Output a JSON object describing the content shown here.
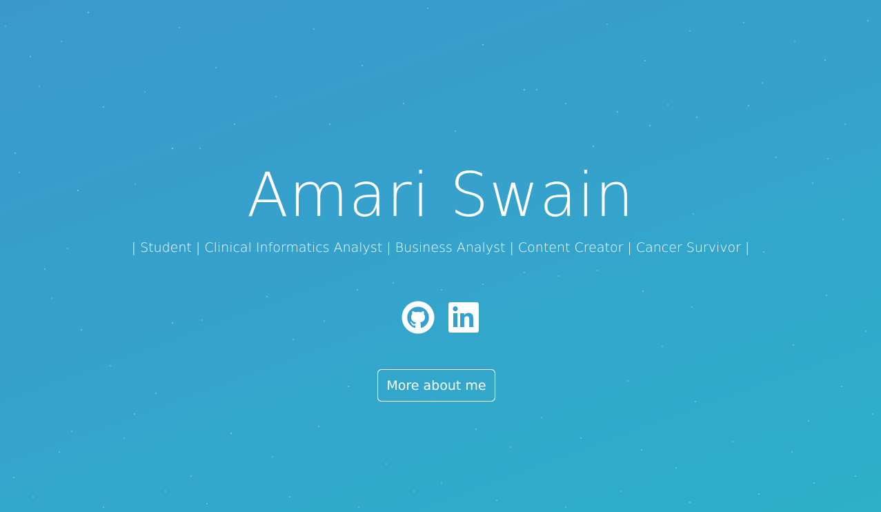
{
  "hero": {
    "name": "Amari Swain",
    "roles": "| Student | Clinical Informatics Analyst | Business Analyst | Content Creator | Cancer Survivor |",
    "colors": {
      "gradient_start": "#3a98cd",
      "gradient_end": "#2db0c8",
      "text": "#ffffff"
    }
  },
  "socials": [
    {
      "icon": "github-icon"
    },
    {
      "icon": "linkedin-icon"
    }
  ],
  "cta": {
    "label": "More about me"
  }
}
